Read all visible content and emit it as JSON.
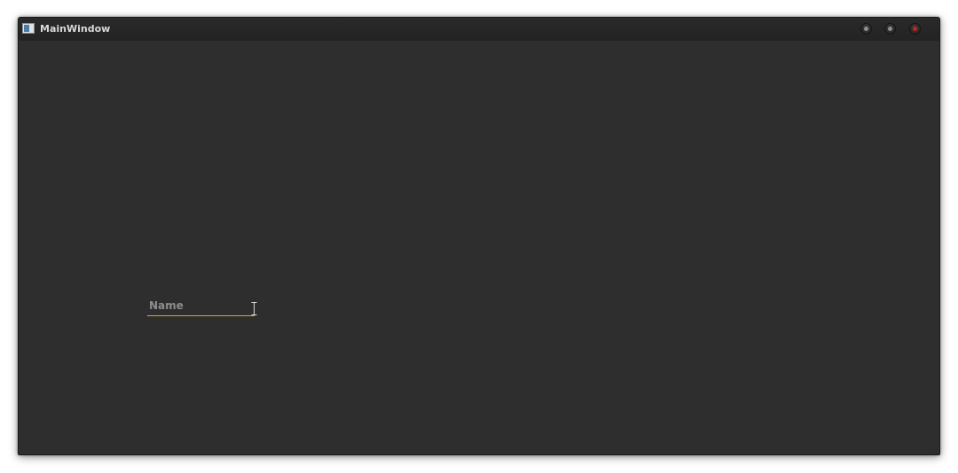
{
  "window": {
    "title": "MainWindow",
    "controls": [
      {
        "name": "minimize",
        "icon": "minimize-dot-icon"
      },
      {
        "name": "maximize",
        "icon": "maximize-dot-icon"
      },
      {
        "name": "close",
        "icon": "close-dot-icon",
        "color": "#c92020"
      }
    ]
  },
  "form": {
    "name_field": {
      "placeholder": "Name",
      "value": "",
      "accent_color": "#e2a21b"
    }
  },
  "cursor": {
    "type": "text-ibeam-icon"
  },
  "colors": {
    "window_background": "#2e2e2e",
    "titlebar_background": "#262626",
    "title_text": "#d8d8d8",
    "placeholder_text": "#8d8d8d"
  }
}
